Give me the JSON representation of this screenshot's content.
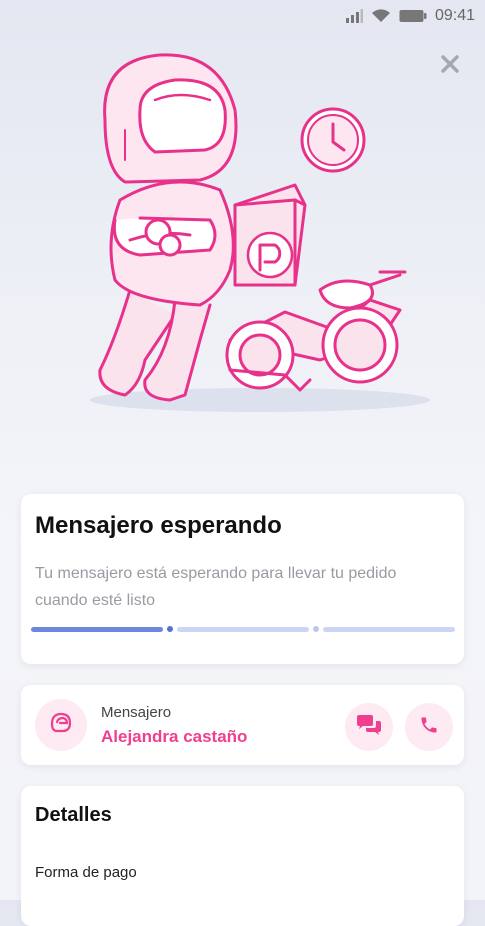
{
  "status_bar": {
    "time": "09:41",
    "icons": [
      "signal-icon",
      "wifi-icon",
      "battery-icon"
    ]
  },
  "colors": {
    "accent": "#ef3f8f",
    "accent_light": "#fdeaf2",
    "progress_active": "#6f86e0",
    "progress_inactive": "#cdd5f4"
  },
  "hero": {
    "icon": "courier-waiting-illustration"
  },
  "status_card": {
    "title": "Mensajero esperando",
    "description": "Tu mensajero está esperando para llevar tu pedido cuando esté listo",
    "progress": {
      "steps": 3,
      "active_step": 1
    }
  },
  "courier": {
    "label": "Mensajero",
    "name": "Alejandra castaño",
    "avatar_icon": "helmet-icon",
    "actions": [
      "chat-icon",
      "phone-icon"
    ]
  },
  "details": {
    "title": "Detalles",
    "payment_label": "Forma de pago"
  }
}
